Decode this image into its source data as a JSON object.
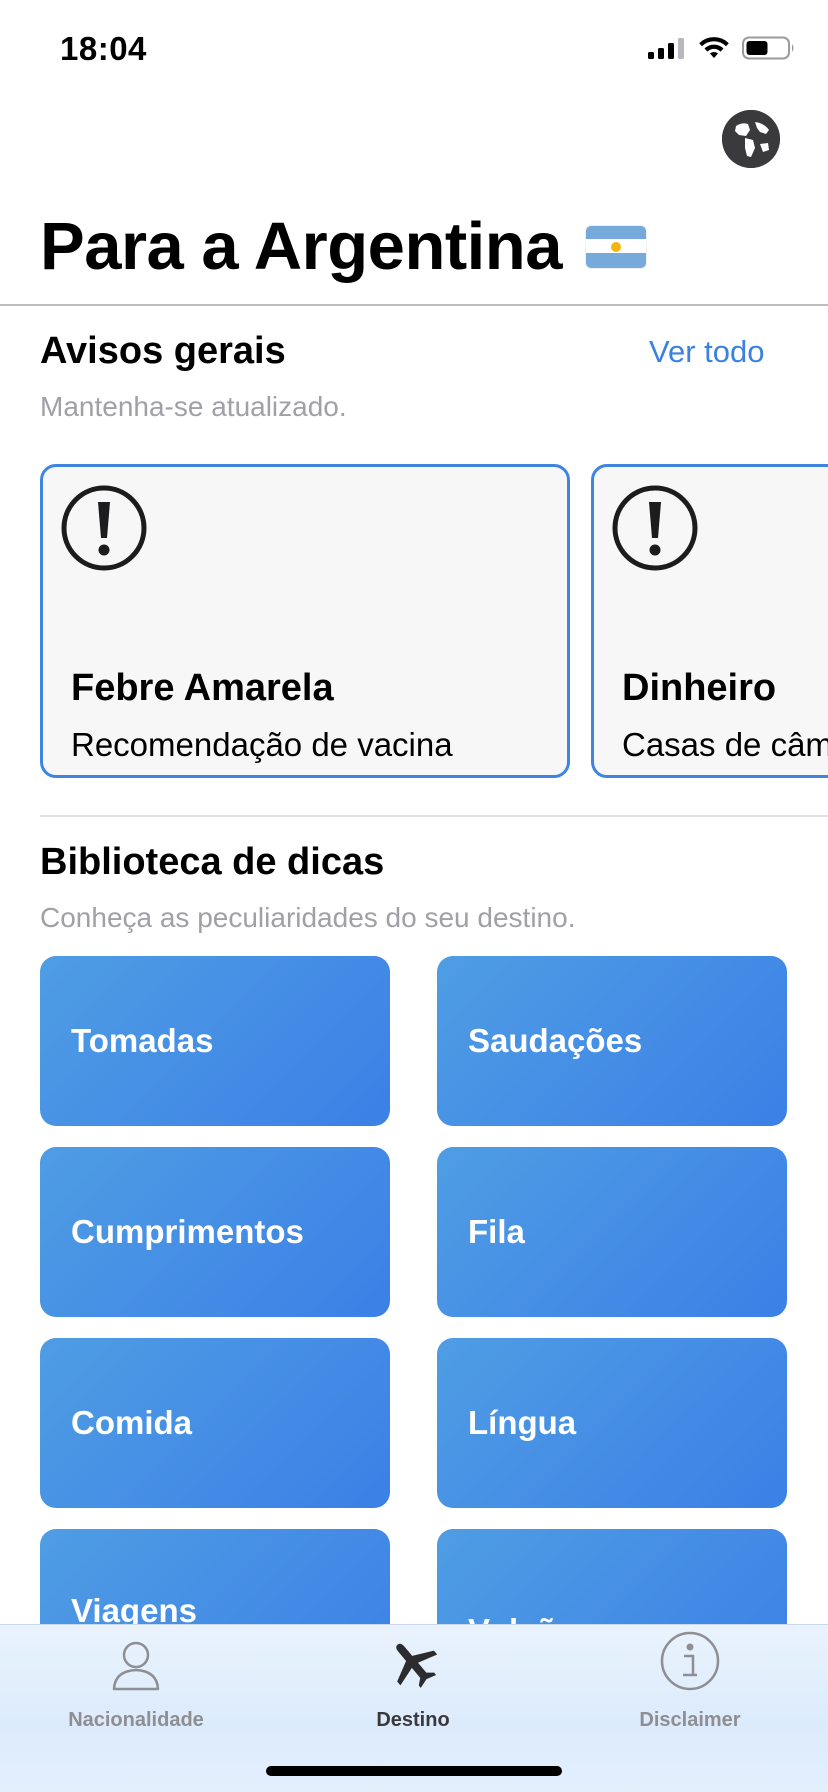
{
  "status_bar": {
    "time": "18:04",
    "icons": [
      "signal-icon",
      "wifi-icon",
      "battery-icon"
    ]
  },
  "header": {
    "title": "Para a Argentina",
    "flag_icon": "argentina-flag-icon",
    "globe_icon": "globe-icon"
  },
  "alerts": {
    "title": "Avisos gerais",
    "see_all": "Ver todo",
    "subtitle": "Mantenha-se atualizado.",
    "cards": [
      {
        "icon": "warning-icon",
        "title": "Febre Amarela",
        "subtitle": "Recomendação de vacina"
      },
      {
        "icon": "warning-icon",
        "title": "Dinheiro",
        "subtitle": "Casas de câm"
      }
    ]
  },
  "tips": {
    "title": "Biblioteca de dicas",
    "subtitle": "Conheça as peculiaridades do seu destino.",
    "items": [
      "Tomadas",
      "Saudações",
      "Cumprimentos",
      "Fila",
      "Comida",
      "Língua",
      "Viagens",
      "Vulcões"
    ]
  },
  "tab_bar": {
    "tabs": [
      {
        "label": "Nacionalidade",
        "icon": "person-icon",
        "active": false
      },
      {
        "label": "Destino",
        "icon": "airplane-icon",
        "active": true
      },
      {
        "label": "Disclaimer",
        "icon": "info-icon",
        "active": false
      }
    ]
  },
  "colors": {
    "accent": "#3b82e0",
    "tile_start": "#4f9de4",
    "tile_end": "#3b80e6",
    "card_border": "#3d85e0",
    "inactive_tab": "#8e8e93",
    "active_tab": "#3a3a3c"
  }
}
